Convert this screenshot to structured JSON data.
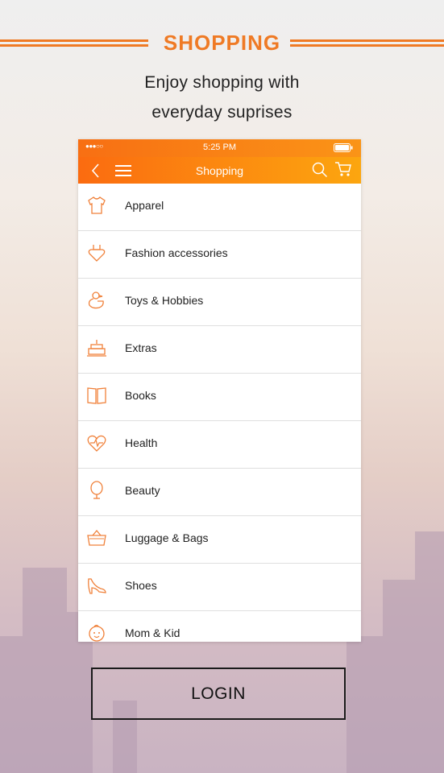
{
  "header": {
    "title": "SHOPPING",
    "subtitle_line1": "Enjoy shopping with",
    "subtitle_line2": "everyday suprises"
  },
  "status_bar": {
    "signal": "●●●○○",
    "time": "5:25 PM"
  },
  "nav_bar": {
    "title": "Shopping",
    "back_icon": "chevron-left-icon",
    "menu_icon": "hamburger-icon",
    "search_icon": "search-icon",
    "cart_icon": "cart-icon"
  },
  "categories": [
    {
      "label": "Apparel",
      "icon": "tshirt-icon"
    },
    {
      "label": "Fashion accessories",
      "icon": "heart-badge-icon"
    },
    {
      "label": "Toys & Hobbies",
      "icon": "duck-icon"
    },
    {
      "label": "Extras",
      "icon": "cake-icon"
    },
    {
      "label": "Books",
      "icon": "book-icon"
    },
    {
      "label": "Health",
      "icon": "heart-pulse-icon"
    },
    {
      "label": "Beauty",
      "icon": "mirror-icon"
    },
    {
      "label": "Luggage & Bags",
      "icon": "bag-icon"
    },
    {
      "label": "Shoes",
      "icon": "heel-shoe-icon"
    },
    {
      "label": "Mom & Kid",
      "icon": "baby-face-icon"
    }
  ],
  "login": {
    "label": "LOGIN"
  },
  "colors": {
    "accent": "#ef7a25",
    "icon": "#f0813a"
  }
}
